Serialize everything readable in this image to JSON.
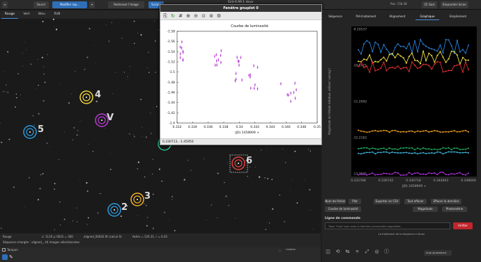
{
  "app": {
    "title": "Siril-0.99.1 dovs",
    "buttons": {
      "open": "Ouvrir",
      "update": "Modifier rep...",
      "reset": "Redresser l'image",
      "script": "Scripts"
    },
    "zoom": "Rev. 158.38",
    "memory": "25 Go/s",
    "user": "Emprunter écran"
  },
  "channel_tabs": [
    "Rouge",
    "Vert",
    "Bleu",
    "RVB"
  ],
  "stars": [
    {
      "label": "4",
      "color": "#f2d43a"
    },
    {
      "label": "V",
      "color": "#b93bd6"
    },
    {
      "label": "5",
      "color": "#2b9be0"
    },
    {
      "label": "6",
      "color": "#e64040"
    },
    {
      "label": "3",
      "color": "#f2b12a"
    },
    {
      "label": "2",
      "color": "#2b9be0"
    }
  ],
  "status": {
    "channel": "Rouge",
    "coords": "x: 1110 y: 0631 = 300",
    "file": "aligned_00042.fit (calcul 0)",
    "fwhm": "fwhm = 120.31, r = 0.43",
    "sequence": "Séquence chargée : aligned_, 44 images sélectionnées"
  },
  "bottom": {
    "checkbox": "Tampon",
    "linear": "Linéaire",
    "auto": "Auto ajustement"
  },
  "gnuplot": {
    "window_title": "Fenêtre gnuplot 0",
    "plot_title": "Courbe de luminosité",
    "xlabel": "(JD) 2458909 +",
    "footer": "0.330713, -1.45950",
    "yticks": [
      "-1.58",
      "-1.56",
      "-1.54",
      "-1.52",
      "-1.5",
      "-1.48",
      "-1.46",
      "-1.44",
      "-1.42",
      "-1.4"
    ],
    "xticks": [
      "0.332",
      "0.334",
      "0.336",
      "0.338",
      "0.34",
      "0.342",
      "0.344",
      "0.346",
      "0.348",
      "0.35"
    ]
  },
  "right_panel": {
    "tabs": [
      "Séquence",
      "Pré-traitement",
      "Alignement",
      "Graphique",
      "Empilement"
    ],
    "ylabel": "Magnitude de l'étoile (relative, utilisez 'vomag')",
    "xlabel": "(JD) 2458909 +",
    "yticks": [
      "-9.19537",
      "-10.2021",
      "-11.2092",
      "-12.2162",
      "-13.2231"
    ],
    "xticks": [
      "0.332768",
      "0.336742",
      "0.340718",
      "0.344693",
      "0.348669"
    ],
    "buttons": {
      "clear": "Nom de fichier",
      "plot": "Plot",
      "export": "Exporter en CSV",
      "all": "Tout effacer",
      "last": "Effacer la dernière",
      "lightcurve": "Courbe de luminosité",
      "magnitude": "Magnitude",
      "photometry": "Photométrie"
    },
    "command_label": "Ligne de commande",
    "command_placeholder": "Taper \"help\" pour avoir la liste des commandes supportées",
    "stop": "Arrêter",
    "processing": "Le traitement de la séquence a réussi"
  }
}
